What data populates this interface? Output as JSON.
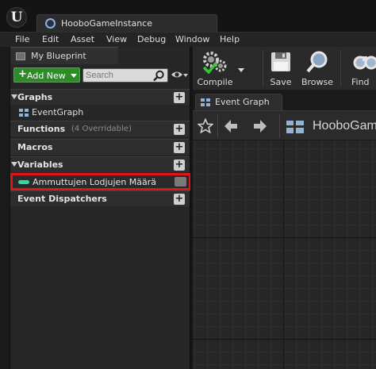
{
  "window": {
    "tab_title": "HooboGameInstance"
  },
  "menu": {
    "items": [
      "File",
      "Edit",
      "Asset",
      "View",
      "Debug",
      "Window",
      "Help"
    ]
  },
  "left_panel": {
    "tab_label": "My Blueprint",
    "add_new_label": "Add New",
    "search_placeholder": "Search",
    "sections": {
      "graphs": {
        "label": "Graphs",
        "items": [
          "EventGraph"
        ]
      },
      "functions": {
        "label": "Functions",
        "sub": "(4 Overridable)"
      },
      "macros": {
        "label": "Macros"
      },
      "variables": {
        "label": "Variables",
        "items": [
          {
            "name": "Ammuttujen Lodjujen Määrä",
            "type_color": "#2ad9a4"
          }
        ]
      },
      "event_dispatchers": {
        "label": "Event Dispatchers"
      }
    },
    "highlight_color": "#e0141b"
  },
  "toolbar": {
    "compile": "Compile",
    "save": "Save",
    "browse": "Browse",
    "find": "Find"
  },
  "graph": {
    "tab_label": "Event Graph",
    "breadcrumb": "HooboGame"
  },
  "icons": [
    "unreal-logo-icon",
    "blueprint-class-icon",
    "blueprint-panel-icon",
    "search-icon",
    "eye-icon",
    "graph-icon",
    "compile-icon",
    "save-icon",
    "browse-icon",
    "find-icon",
    "star-icon",
    "back-arrow-icon",
    "forward-arrow-icon"
  ]
}
